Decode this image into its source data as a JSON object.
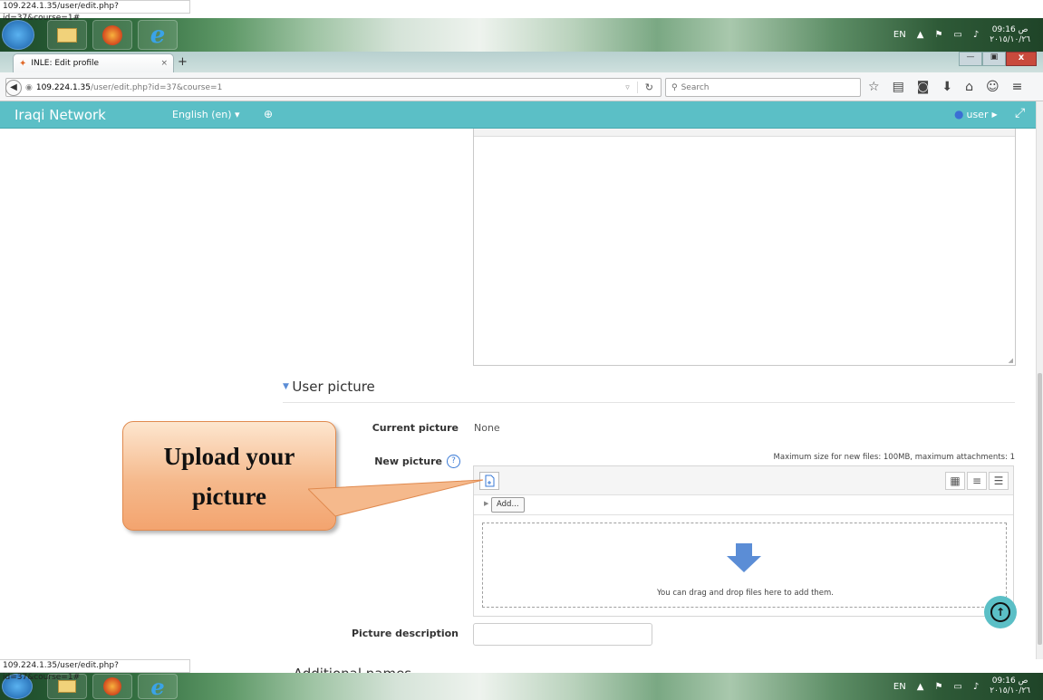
{
  "status_url": "109.224.1.35/user/edit.php?id=37&course=1#",
  "tab": {
    "title": "INLE: Edit profile",
    "close": "×",
    "new": "+"
  },
  "address": {
    "host": "109.224.1.35",
    "path": "/user/edit.php?id=37&course=1",
    "search_placeholder": "Search"
  },
  "tray": {
    "lang": "EN",
    "time": "09:16 ص",
    "date": "٢٠١٥/١٠/٢٦"
  },
  "moodle": {
    "site_name": "Iraqi Network",
    "language": "English (en)",
    "user": "user"
  },
  "section": {
    "title": "User picture"
  },
  "fields": {
    "current_picture_label": "Current picture",
    "current_picture_value": "None",
    "new_picture_label": "New picture",
    "max_size": "Maximum size for new files: 100MB, maximum attachments: 1",
    "add_button": "Add...",
    "drop_text": "You can drag and drop files here to add them.",
    "picture_description_label": "Picture description",
    "additional_names": "Additional names"
  },
  "callout": {
    "line1": "Upload your",
    "line2": "picture"
  },
  "colors": {
    "accent": "#5bbfc6",
    "callout": "#f5b98c"
  }
}
